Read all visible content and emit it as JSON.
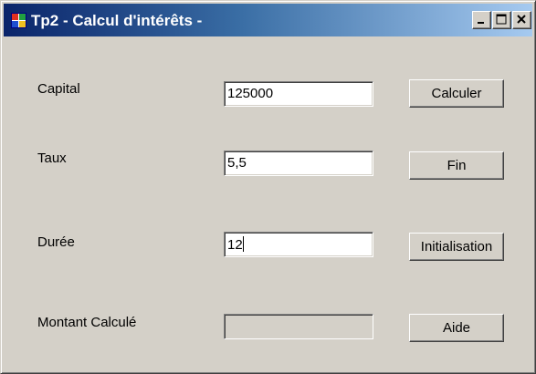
{
  "window": {
    "title": "Tp2 - Calcul d'intérêts -",
    "icon": "windows-form-icon",
    "controls": [
      "minimize-icon",
      "maximize-icon",
      "close-icon"
    ]
  },
  "form": {
    "capital_label": "Capital",
    "capital_value": "125000",
    "taux_label": "Taux",
    "taux_value": "5,5",
    "duree_label": "Durée",
    "duree_value": "12",
    "montant_label": "Montant Calculé",
    "montant_value": ""
  },
  "buttons": {
    "calculer": "Calculer",
    "fin": "Fin",
    "initialisation": "Initialisation",
    "aide": "Aide"
  },
  "colors": {
    "face": "#d4d0c8",
    "title_start": "#0a246a",
    "title_end": "#a6caf0"
  }
}
